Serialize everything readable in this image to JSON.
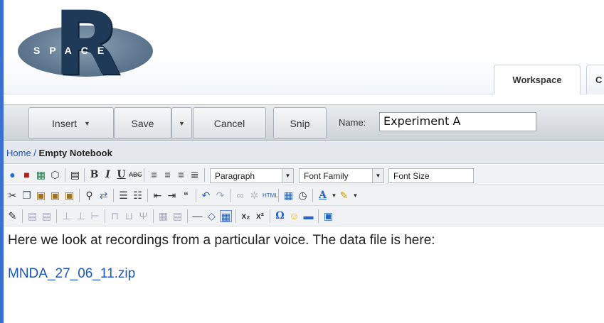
{
  "logo": {
    "letter": "R",
    "word": "SPACE"
  },
  "tabs": [
    {
      "label": "Workspace"
    },
    {
      "label": "C"
    }
  ],
  "toolbar": {
    "insert_label": "Insert",
    "save_label": "Save",
    "cancel_label": "Cancel",
    "snip_label": "Snip",
    "name_label": "Name:",
    "name_value": "Experiment A"
  },
  "breadcrumb": {
    "home": "Home",
    "separator": " / ",
    "current": "Empty Notebook"
  },
  "editor": {
    "format_select": "Paragraph",
    "font_family_select": "Font Family",
    "font_size_select": "Font Size",
    "row1_icons": [
      "speech-bubble-icon",
      "film-strip-icon",
      "grid-image-icon",
      "shield-icon",
      "keyboard-icon",
      "bold-icon",
      "italic-icon",
      "underline-icon",
      "strikethrough-icon",
      "align-left-icon",
      "align-center-icon",
      "align-right-icon",
      "align-justify-icon"
    ],
    "row2_icons": [
      "cut-icon",
      "copy-icon",
      "paste-icon",
      "paste-text-icon",
      "paste-word-icon",
      "find-icon",
      "replace-icon",
      "bullet-list-icon",
      "numbered-list-icon",
      "outdent-icon",
      "indent-icon",
      "blockquote-icon",
      "undo-icon",
      "redo-icon",
      "link-icon",
      "unlink-icon",
      "html-icon",
      "calendar-icon",
      "clock-icon",
      "text-color-icon",
      "highlight-icon"
    ],
    "row3_icons": [
      "edit-icon",
      "table-icon",
      "table-props-icon",
      "insert-row-icon",
      "delete-row-icon",
      "insert-col-icon",
      "split-cell-icon",
      "merge-cell-icon",
      "hr-icon",
      "eraser-icon",
      "visual-aid-icon",
      "subscript-icon",
      "superscript-icon",
      "omega-icon",
      "smiley-icon",
      "line-icon",
      "fullscreen-icon"
    ]
  },
  "content": {
    "paragraph": "Here we look at recordings from a particular voice.  The data file is here:",
    "link": "MNDA_27_06_11.zip"
  },
  "colors": {
    "link": "#1a56c4",
    "logo_dark": "#1f3a57",
    "logo_ellipse": "#6b8399"
  }
}
